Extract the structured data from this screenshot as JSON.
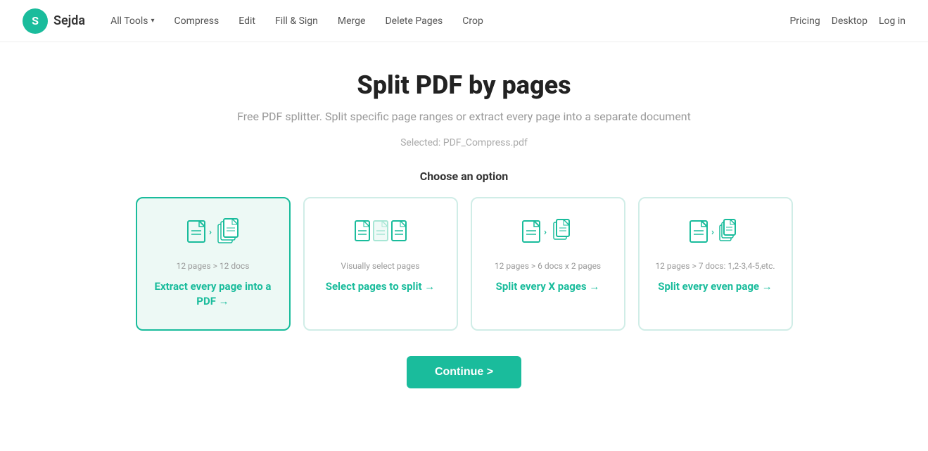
{
  "header": {
    "logo_letter": "S",
    "logo_name": "Sejda",
    "nav": [
      {
        "label": "All Tools",
        "has_chevron": true
      },
      {
        "label": "Compress",
        "has_chevron": false
      },
      {
        "label": "Edit",
        "has_chevron": false
      },
      {
        "label": "Fill & Sign",
        "has_chevron": false
      },
      {
        "label": "Merge",
        "has_chevron": false
      },
      {
        "label": "Delete Pages",
        "has_chevron": false
      },
      {
        "label": "Crop",
        "has_chevron": false
      }
    ],
    "nav_right": [
      {
        "label": "Pricing"
      },
      {
        "label": "Desktop"
      },
      {
        "label": "Log in"
      }
    ]
  },
  "main": {
    "title": "Split PDF by pages",
    "subtitle": "Free PDF splitter. Split specific page ranges or extract every page into a separate document",
    "selected_file_label": "Selected: PDF_Compress.pdf",
    "choose_option": "Choose an option",
    "cards": [
      {
        "sub_label": "12 pages > 12 docs",
        "main_label": "Extract every page into a PDF →",
        "selected": true,
        "icon_type": "single_to_multi"
      },
      {
        "sub_label": "Visually select pages",
        "main_label": "Select pages to split →",
        "selected": false,
        "icon_type": "visual_select"
      },
      {
        "sub_label": "12 pages > 6 docs x 2 pages",
        "main_label": "Split every X pages →",
        "selected": false,
        "icon_type": "split_x"
      },
      {
        "sub_label": "12 pages > 7 docs: 1,2-3,4-5,etc.",
        "main_label": "Split every even page →",
        "selected": false,
        "icon_type": "split_even"
      }
    ],
    "continue_button": "Continue >"
  }
}
